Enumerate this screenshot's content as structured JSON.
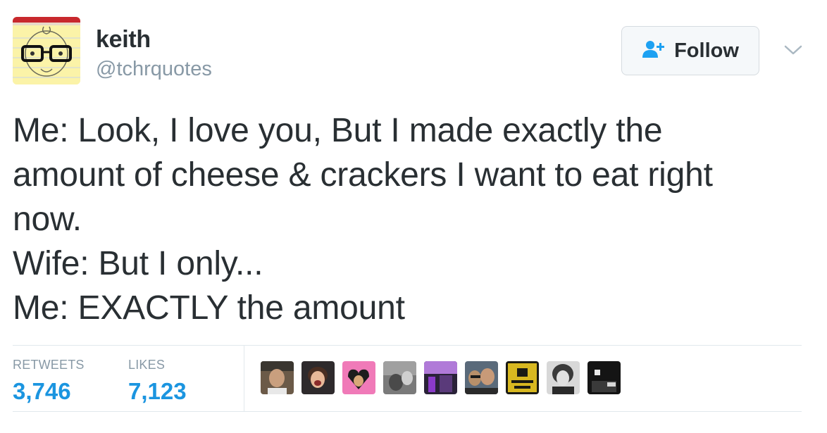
{
  "user": {
    "display_name": "keith",
    "handle": "@tchrquotes"
  },
  "follow_button": {
    "label": "Follow",
    "icon": "follow-person-plus-icon"
  },
  "menu_caret": {
    "icon": "chevron-down-icon"
  },
  "tweet": {
    "lines": [
      "Me: Look, I love you, But I made exactly the",
      "amount of cheese & crackers I want to eat right",
      "now.",
      "Wife: But I only...",
      "Me: EXACTLY the amount"
    ]
  },
  "stats": {
    "retweets_label": "RETWEETS",
    "retweets_value": "3,746",
    "likes_label": "LIKES",
    "likes_value": "7,123"
  },
  "likers": [
    {
      "name": "liker-avatar-1"
    },
    {
      "name": "liker-avatar-2"
    },
    {
      "name": "liker-avatar-3"
    },
    {
      "name": "liker-avatar-4"
    },
    {
      "name": "liker-avatar-5"
    },
    {
      "name": "liker-avatar-6"
    },
    {
      "name": "liker-avatar-7",
      "text": "DOUCHE MOUTH"
    },
    {
      "name": "liker-avatar-8"
    },
    {
      "name": "liker-avatar-9"
    }
  ],
  "colors": {
    "link_blue": "#1b95e0",
    "text_dark": "#292f33",
    "text_muted": "#8899a6",
    "follow_icon_blue": "#1da1f2"
  }
}
